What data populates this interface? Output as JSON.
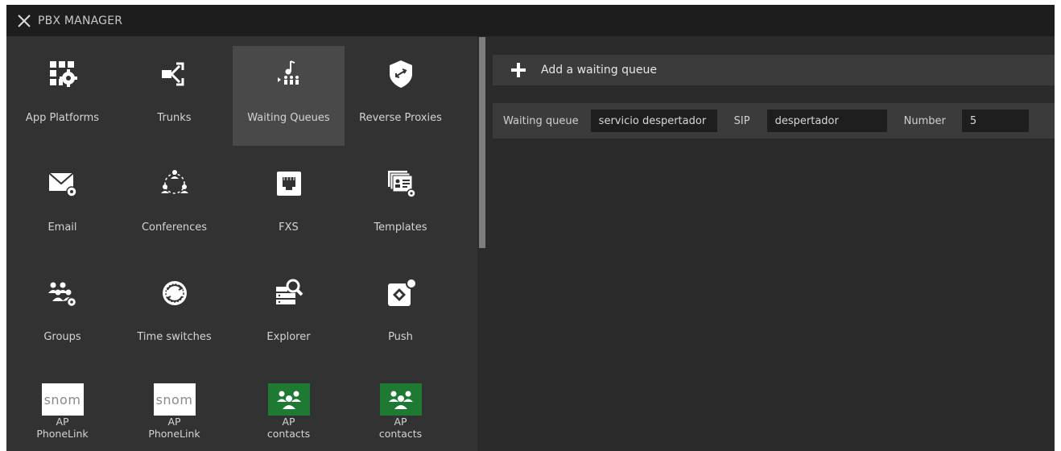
{
  "app": {
    "title": "PBX MANAGER"
  },
  "tiles": [
    {
      "label": "App Platforms",
      "icon": "app-platforms-icon"
    },
    {
      "label": "Trunks",
      "icon": "trunks-icon"
    },
    {
      "label": "Waiting Queues",
      "icon": "waiting-queues-icon",
      "active": true
    },
    {
      "label": "Reverse Proxies",
      "icon": "reverse-proxies-icon"
    },
    {
      "label": "Email",
      "icon": "email-icon"
    },
    {
      "label": "Conferences",
      "icon": "conferences-icon"
    },
    {
      "label": "FXS",
      "icon": "fxs-icon"
    },
    {
      "label": "Templates",
      "icon": "templates-icon"
    },
    {
      "label": "Groups",
      "icon": "groups-icon"
    },
    {
      "label": "Time switches",
      "icon": "time-switches-icon"
    },
    {
      "label": "Explorer",
      "icon": "explorer-icon"
    },
    {
      "label": "Push",
      "icon": "push-icon"
    },
    {
      "label": "AP\nPhoneLink",
      "logo_text": "snom",
      "icon": "snom-logo"
    },
    {
      "label": "AP\nPhoneLink",
      "logo_text": "snom",
      "icon": "snom-logo"
    },
    {
      "label": "AP\ncontacts",
      "icon": "contacts-icon"
    },
    {
      "label": "AP\ncontacts",
      "icon": "contacts-icon"
    }
  ],
  "queue": {
    "add_label": "Add a waiting queue",
    "row": {
      "queue_label": "Waiting queue",
      "queue_value": "servicio despertador",
      "sip_label": "SIP",
      "sip_value": "despertador",
      "number_label": "Number",
      "number_value": "5"
    }
  },
  "colors": {
    "active_tile": "#494949",
    "contacts_green": "#1e7a32"
  }
}
